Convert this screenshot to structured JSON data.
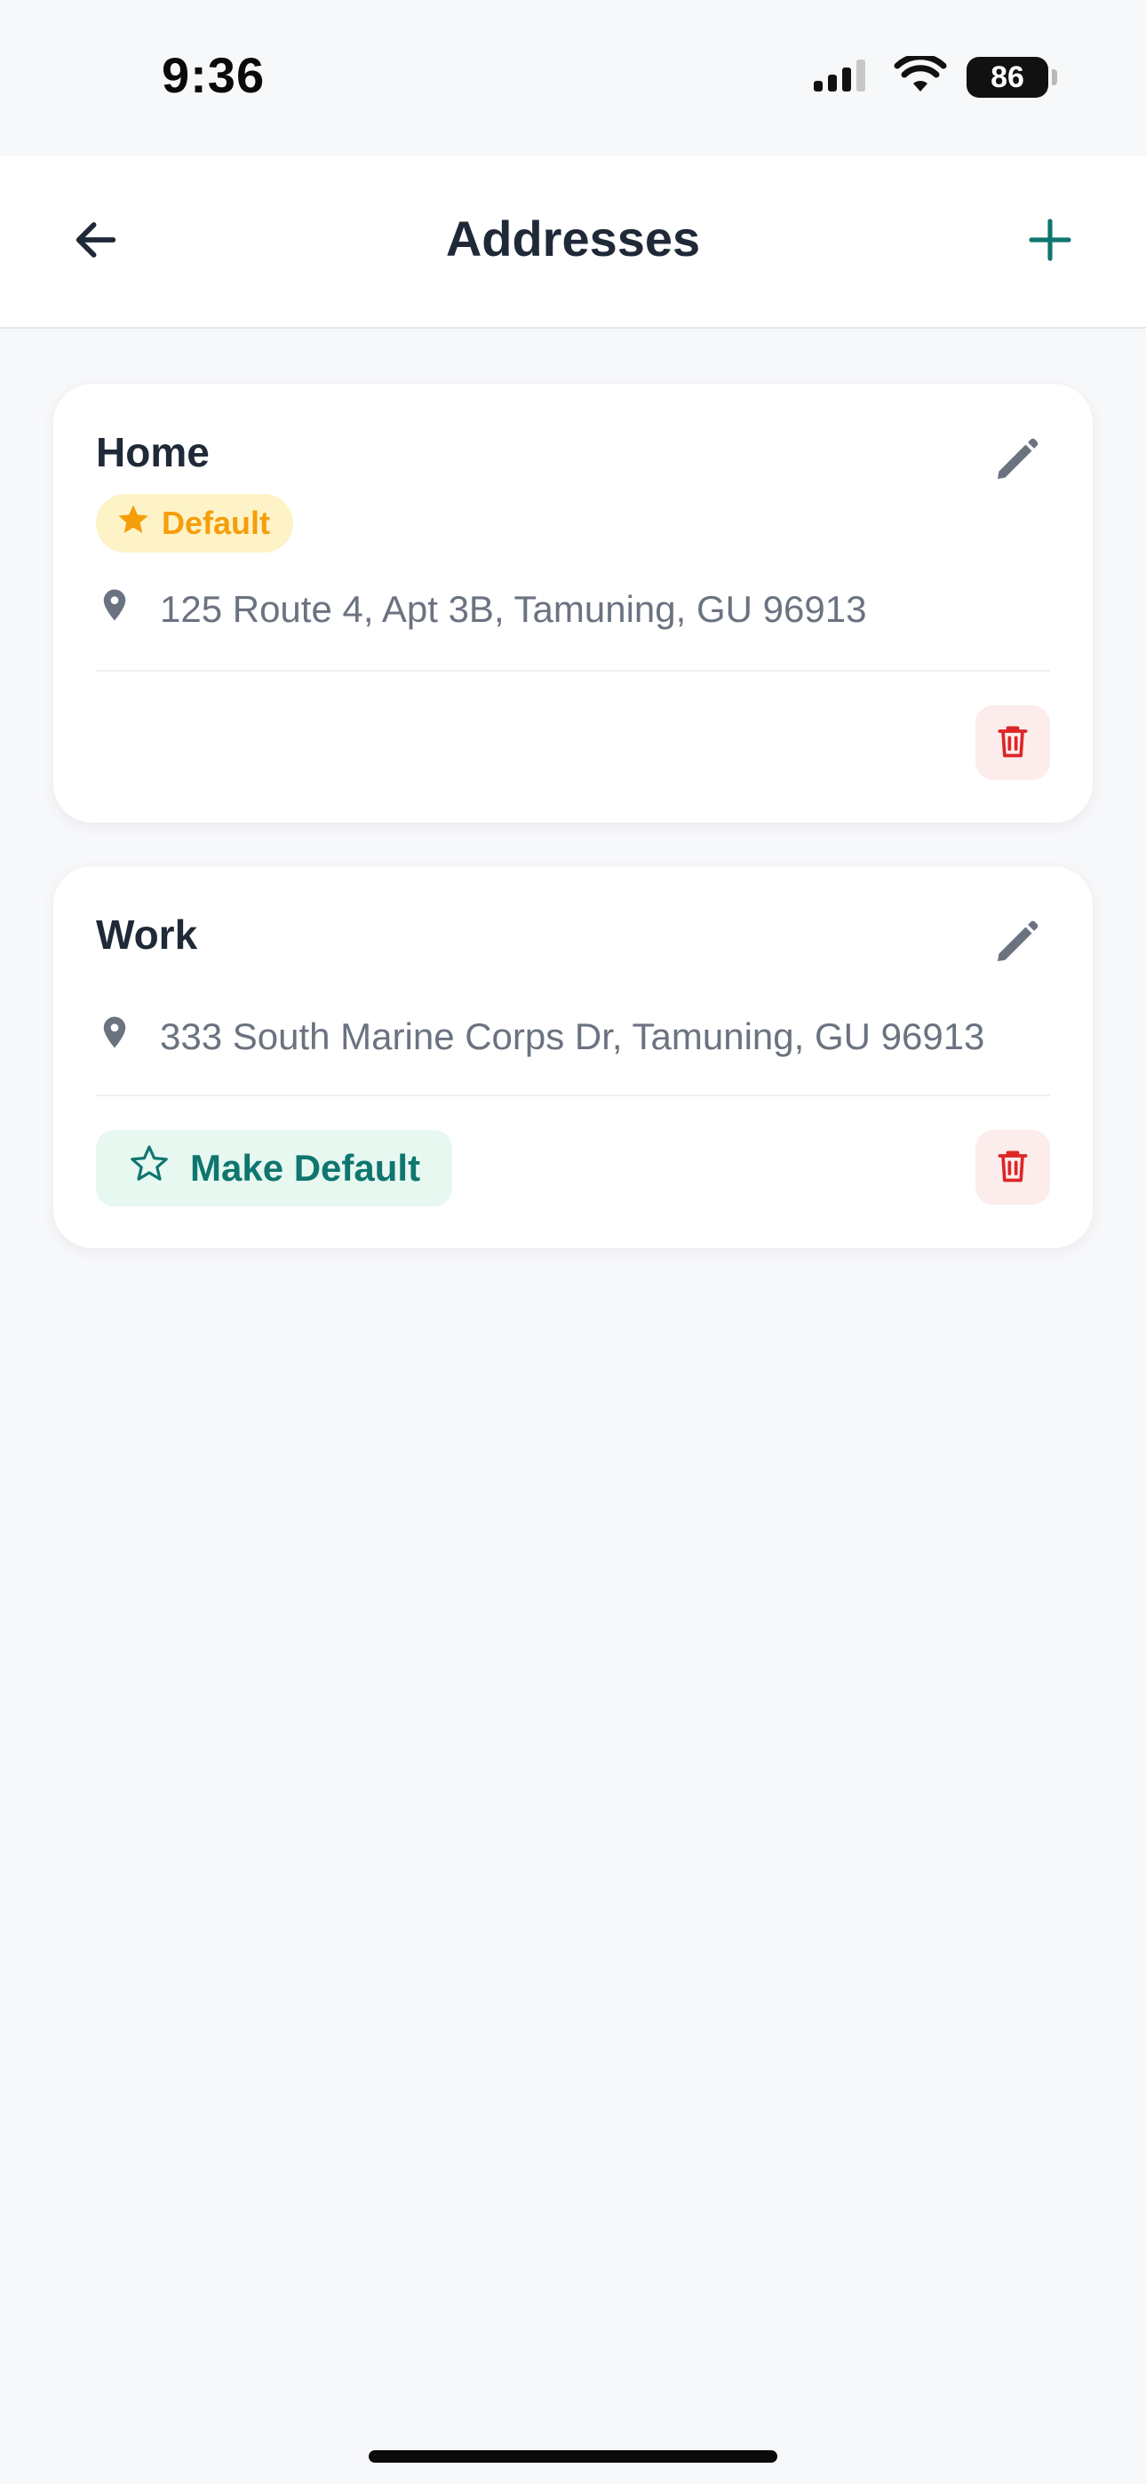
{
  "status_bar": {
    "time": "9:36",
    "battery_level": "86"
  },
  "header": {
    "title": "Addresses"
  },
  "addresses": [
    {
      "label": "Home",
      "is_default": true,
      "default_badge": "Default",
      "address": "125 Route 4, Apt 3B, Tamuning, GU 96913"
    },
    {
      "label": "Work",
      "is_default": false,
      "make_default_label": "Make Default",
      "address": "333 South Marine Corps Dr, Tamuning, GU 96913"
    }
  ],
  "colors": {
    "accent": "#0f766e",
    "default_badge_bg": "#fef3c7",
    "default_badge_text": "#f59e0b",
    "delete_bg": "#fdecec",
    "delete_icon": "#dc2626",
    "make_default_bg": "#e7f8f1",
    "muted_text": "#6b7280"
  },
  "icons": {
    "back": "arrow-left-icon",
    "add": "plus-icon",
    "edit": "pencil-icon",
    "delete": "trash-icon",
    "location": "map-pin-icon",
    "default_star": "star-filled-icon",
    "make_default_star": "star-outline-icon"
  }
}
